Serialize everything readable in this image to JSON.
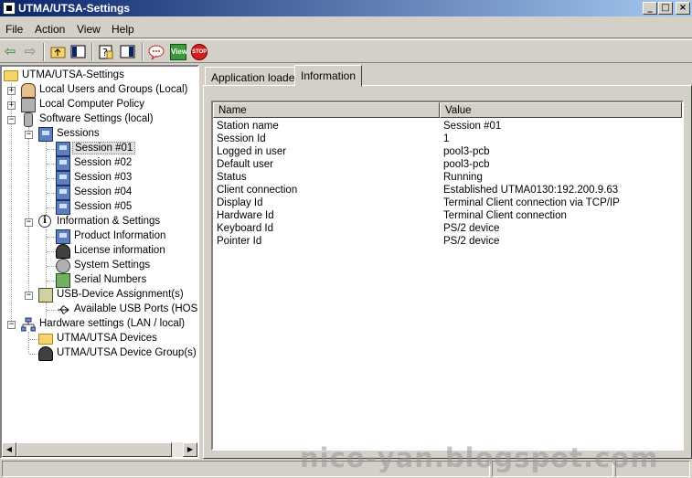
{
  "window": {
    "title": "UTMA/UTSA-Settings",
    "minimize": "_",
    "maximize": "□",
    "close": "×"
  },
  "menu": [
    {
      "label": "File"
    },
    {
      "label": "Action"
    },
    {
      "label": "View"
    },
    {
      "label": "Help"
    }
  ],
  "toolbar": {
    "back_glyph": "⇦",
    "forward_glyph": "⇨",
    "view_label": "View",
    "stop_label": "STOP",
    "icons": [
      "back-icon",
      "forward-icon",
      "up-folder-icon",
      "show-hide-tree-icon",
      "help-icon",
      "properties-icon",
      "message-icon",
      "view-icon",
      "stop-icon"
    ]
  },
  "tree": {
    "root": "UTMA/UTSA-Settings",
    "local_users": "Local Users and Groups (Local)",
    "local_policy": "Local Computer Policy",
    "software_settings": "Software Settings (local)",
    "sessions": "Sessions",
    "session_items": [
      "Session #01",
      "Session #02",
      "Session #03",
      "Session #04",
      "Session #05"
    ],
    "info_settings": "Information & Settings",
    "info_items": [
      "Product Information",
      "License information",
      "System Settings",
      "Serial Numbers"
    ],
    "usb_assign": "USB-Device Assignment(s)",
    "usb_ports": "Available USB Ports (HOST-F",
    "hardware": "Hardware settings (LAN / local)",
    "devices": "UTMA/UTSA Devices",
    "device_groups": "UTMA/UTSA Device Group(s)",
    "expand_plus": "+",
    "expand_minus": "−",
    "selected": "Session #01"
  },
  "tabs": [
    {
      "label": "Application loaded"
    },
    {
      "label": "Information"
    }
  ],
  "list": {
    "columns": [
      "Name",
      "Value"
    ],
    "rows": [
      {
        "name": "Station name",
        "value": "Session #01"
      },
      {
        "name": "Session Id",
        "value": "1"
      },
      {
        "name": "Logged in user",
        "value": "pool3-pcb"
      },
      {
        "name": "Default user",
        "value": "pool3-pcb"
      },
      {
        "name": "Status",
        "value": "Running"
      },
      {
        "name": "Client connection",
        "value": "Established UTMA0130:192.200.9.63"
      },
      {
        "name": "Display Id",
        "value": "Terminal Client connection via TCP/IP"
      },
      {
        "name": "Hardware Id",
        "value": "Terminal Client connection"
      },
      {
        "name": "Keyboard Id",
        "value": "PS/2 device"
      },
      {
        "name": "Pointer Id",
        "value": "PS/2 device"
      }
    ]
  },
  "scroll": {
    "left": "◀",
    "right": "▶"
  },
  "watermark": "nico-yan.blogspot.com"
}
